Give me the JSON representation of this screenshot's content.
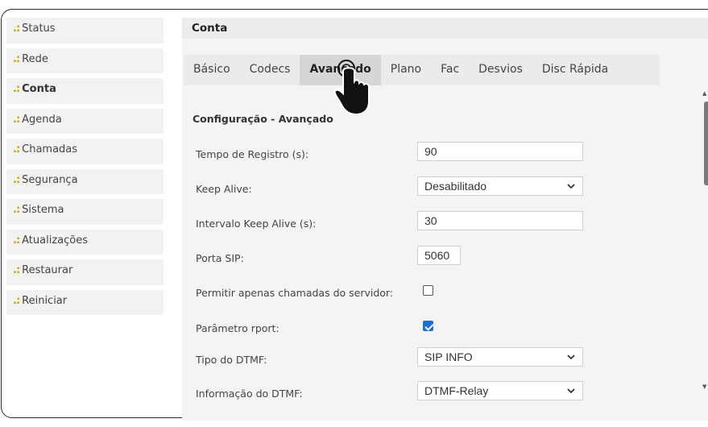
{
  "sidebar": {
    "bullet": ".:",
    "items": [
      {
        "label": "Status"
      },
      {
        "label": "Rede"
      },
      {
        "label": "Conta"
      },
      {
        "label": "Agenda"
      },
      {
        "label": "Chamadas"
      },
      {
        "label": "Segurança"
      },
      {
        "label": "Sistema"
      },
      {
        "label": "Atualizações"
      },
      {
        "label": "Restaurar"
      },
      {
        "label": "Reiniciar"
      }
    ],
    "active": "Conta"
  },
  "main": {
    "section_title": "Conta",
    "tabs": [
      {
        "label": "Básico"
      },
      {
        "label": "Codecs"
      },
      {
        "label": "Avançado"
      },
      {
        "label": "Plano"
      },
      {
        "label": "Fac"
      },
      {
        "label": "Desvios"
      },
      {
        "label": "Disc Rápida"
      }
    ],
    "active_tab": "Avançado",
    "config_title": "Configuração - Avançado",
    "fields": {
      "tempo_registro": {
        "label": "Tempo de Registro (s):",
        "value": "90"
      },
      "keep_alive": {
        "label": "Keep Alive:",
        "value": "Desabilitado"
      },
      "intervalo_keep_alive": {
        "label": "Intervalo Keep Alive (s):",
        "value": "30"
      },
      "porta_sip": {
        "label": "Porta SIP:",
        "value": "5060"
      },
      "permitir_servidor": {
        "label": "Permitir apenas chamadas do servidor:",
        "checked": false
      },
      "parametro_rport": {
        "label": "Parâmetro rport:",
        "checked": true
      },
      "tipo_dtmf": {
        "label": "Tipo do DTMF:",
        "value": "SIP INFO"
      },
      "info_dtmf": {
        "label": "Informação do DTMF:",
        "value": "DTMF-Relay"
      }
    }
  },
  "icons": {
    "select_chevron": "❯",
    "scroll_up": "▲",
    "scroll_down": "▼"
  },
  "colors": {
    "accent_bullet": "#c9a400",
    "checkbox_checked": "#1a6fd1",
    "active_tab_bg": "#d6d6d6"
  }
}
